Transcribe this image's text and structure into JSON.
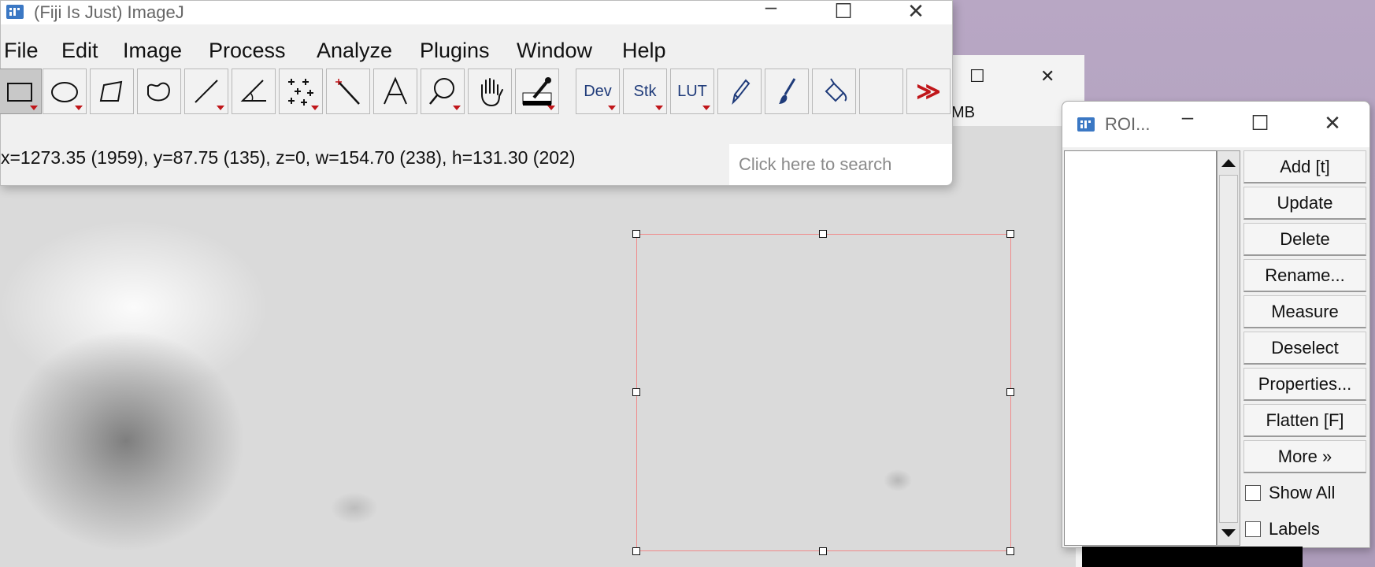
{
  "imagej": {
    "title": "(Fiji Is Just) ImageJ",
    "menu": [
      "File",
      "Edit",
      "Image",
      "Process",
      "Analyze",
      "Plugins",
      "Window",
      "Help"
    ],
    "tools": {
      "dev": "Dev",
      "stk": "Stk",
      "lut": "LUT",
      "more": "≫"
    },
    "status": "x=1273.35 (1959), y=87.75 (135), z=0, w=154.70 (238), h=131.30 (202)",
    "search_placeholder": "Click here to search"
  },
  "image_window": {
    "info_suffix": "MB"
  },
  "roi_manager": {
    "title": "ROI...",
    "buttons": [
      "Add [t]",
      "Update",
      "Delete",
      "Rename...",
      "Measure",
      "Deselect",
      "Properties...",
      "Flatten [F]",
      "More »"
    ],
    "checkboxes": [
      "Show All",
      "Labels"
    ]
  },
  "window_controls": {
    "minimize": "–",
    "maximize": "☐",
    "close": "✕"
  }
}
